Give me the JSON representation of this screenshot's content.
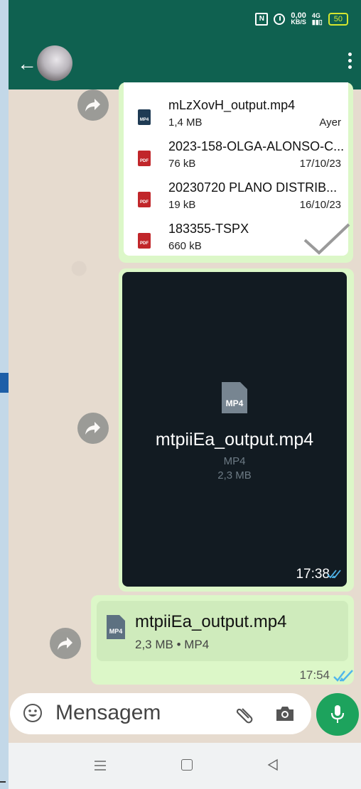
{
  "status_bar": {
    "nfc": "N",
    "net_speed_value": "0,00",
    "net_speed_unit": "KB/S",
    "network": "4G",
    "battery": "50"
  },
  "app_bar": {
    "back_icon": "arrow-left-icon",
    "menu_icon": "more-vert-icon"
  },
  "documents": [
    {
      "type": "MP4",
      "name": "mLzXovH_output.mp4",
      "size": "1,4 MB",
      "date": "Ayer"
    },
    {
      "type": "PDF",
      "name": "2023-158-OLGA-ALONSO-C...",
      "size": "76 kB",
      "date": "17/10/23"
    },
    {
      "type": "PDF",
      "name": "20230720 PLANO DISTRIB...",
      "size": "19 kB",
      "date": "16/10/23"
    },
    {
      "type": "PDF",
      "name": "183355-TSPX",
      "size": "660 kB",
      "date": ""
    }
  ],
  "video_message": {
    "icon_label": "MP4",
    "file_name": "mtpiiEa_output.mp4",
    "file_type": "MP4",
    "file_size": "2,3 MB",
    "time": "17:38"
  },
  "file_message": {
    "icon_label": "MP4",
    "file_name": "mtpiiEa_output.mp4",
    "meta": "2,3 MB • MP4",
    "time": "17:54"
  },
  "composer": {
    "placeholder": "Mensagem"
  },
  "colors": {
    "header": "#0f6150",
    "outgoing_bubble": "#dcf7c8",
    "read_ticks": "#4fb6ec",
    "mic_button": "#1da35d"
  }
}
